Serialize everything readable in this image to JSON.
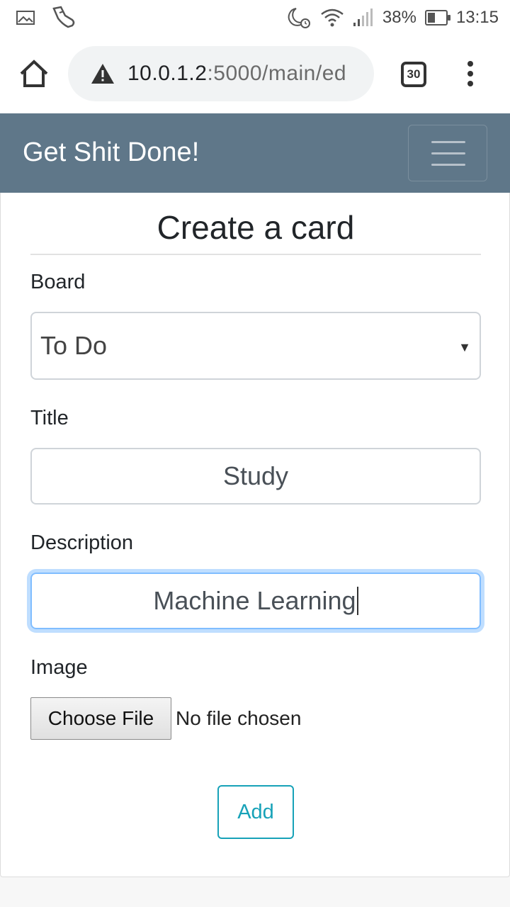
{
  "status_bar": {
    "battery": "38%",
    "time": "13:15",
    "icons": [
      "gallery-icon",
      "sneaker-icon",
      "moon-alarm-icon",
      "wifi-icon",
      "signal-icon",
      "battery-icon"
    ]
  },
  "browser": {
    "url_host": "10.0.1.2",
    "url_path": ":5000/main/ed",
    "tab_count": "30"
  },
  "navbar": {
    "brand": "Get Shit Done!"
  },
  "form": {
    "title": "Create a card",
    "board_label": "Board",
    "board_value": "To Do",
    "title_label": "Title",
    "title_value": "Study",
    "description_label": "Description",
    "description_value": "Machine Learning",
    "image_label": "Image",
    "choose_file_label": "Choose File",
    "file_status": "No file chosen",
    "submit_label": "Add"
  },
  "colors": {
    "navbar_bg": "#5f7789",
    "accent": "#17a2b8",
    "focus_ring": "#80bdff"
  }
}
